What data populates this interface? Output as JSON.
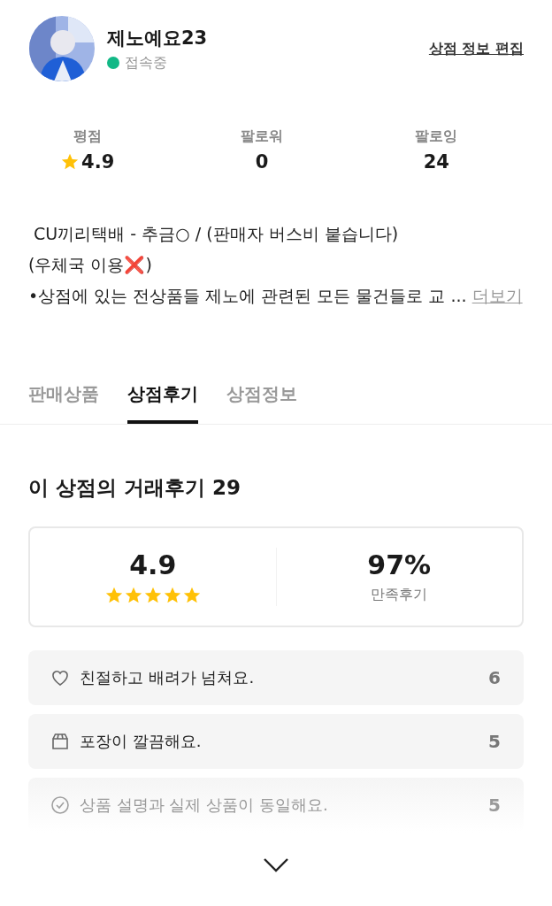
{
  "profile": {
    "name": "제노예요23",
    "status": {
      "text": "접속중",
      "color": "#12b886"
    },
    "edit_link": "상점 정보 편집"
  },
  "stats": [
    {
      "kind": "rating",
      "label": "평점",
      "value": "4.9"
    },
    {
      "kind": "plain",
      "label": "팔로워",
      "value": "0"
    },
    {
      "kind": "plain",
      "label": "팔로잉",
      "value": "24"
    }
  ],
  "bio": {
    "lines": [
      " CU끼리택배 - 추금○ / (판매자 버스비 붙습니다)",
      "(우체국 이용❌)",
      "•상점에 있는 전상품들 제노에 관련된 모든 물건들로 교 ..."
    ],
    "more_link": "더보기"
  },
  "tabs": [
    {
      "label": "판매상품",
      "selected": false
    },
    {
      "label": "상점후기",
      "selected": true
    },
    {
      "label": "상점정보",
      "selected": false
    }
  ],
  "reviews_heading": "이 상점의 거래후기 29",
  "summary": {
    "score": "4.9",
    "stars": 5,
    "percent": "97%",
    "percent_label": "만족후기"
  },
  "review_tags": [
    {
      "kind": "heart",
      "text": "친절하고 배려가 넘쳐요.",
      "count": "6",
      "faded": false
    },
    {
      "kind": "box",
      "text": "포장이 깔끔해요.",
      "count": "5",
      "faded": false
    },
    {
      "kind": "check",
      "text": "상품 설명과 실제 상품이 동일해요.",
      "count": "5",
      "faded": true
    }
  ]
}
